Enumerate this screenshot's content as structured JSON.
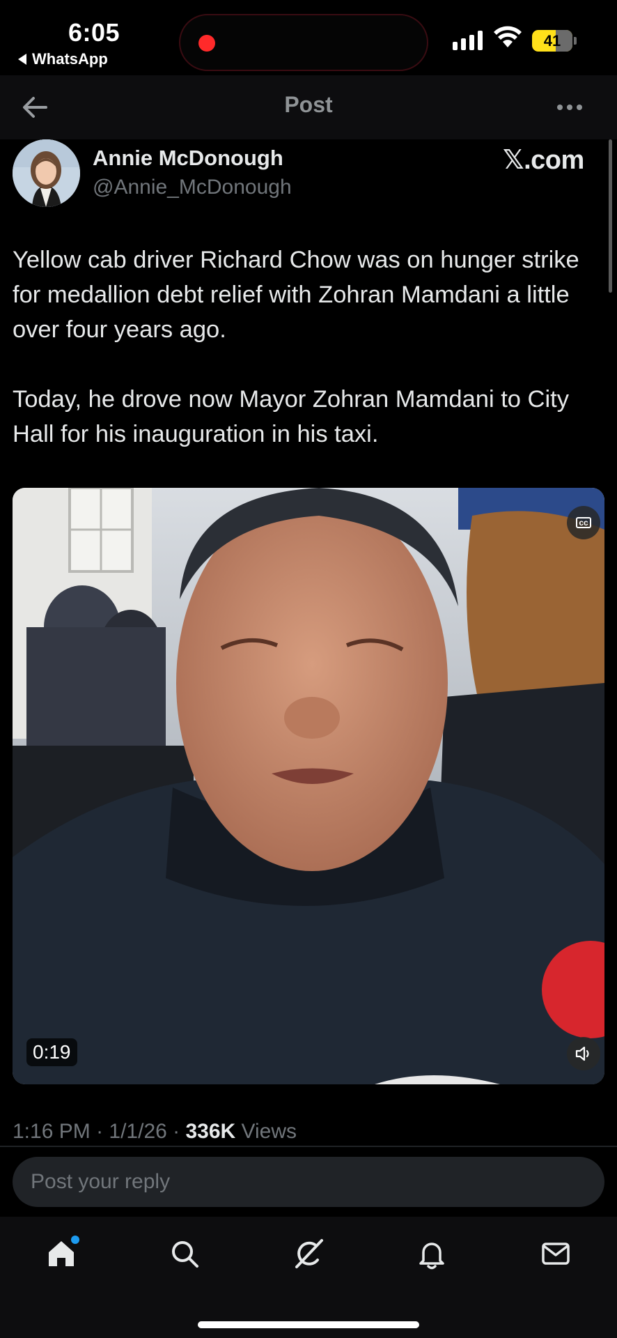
{
  "status_bar": {
    "time": "6:05",
    "back_app": "WhatsApp",
    "battery": "41",
    "recording_color": "#ff2a2a",
    "battery_color": "#ffe01a"
  },
  "top_bar": {
    "title": "Post"
  },
  "post": {
    "author_name": "Annie McDonough",
    "author_handle": "@Annie_McDonough",
    "source": "𝕏.com",
    "text": "Yellow cab driver Richard Chow was on hunger strike for medallion debt relief with Zohran Mamdani a little over four years ago.\n\nToday, he drove now Mayor Zohran Mamdani to City Hall for his inauguration in his taxi.",
    "video": {
      "duration": "0:19",
      "captions_label": "cc"
    },
    "time": "1:16 PM",
    "date": "1/1/26",
    "separator": " · ",
    "views_count": "336K",
    "views_label": " Views"
  },
  "reply": {
    "placeholder": "Post your reply"
  },
  "nav": {
    "items": [
      "home-icon",
      "search-icon",
      "grok-icon",
      "notifications-icon",
      "messages-icon"
    ],
    "active": "home",
    "accent": "#1d9bf0"
  }
}
